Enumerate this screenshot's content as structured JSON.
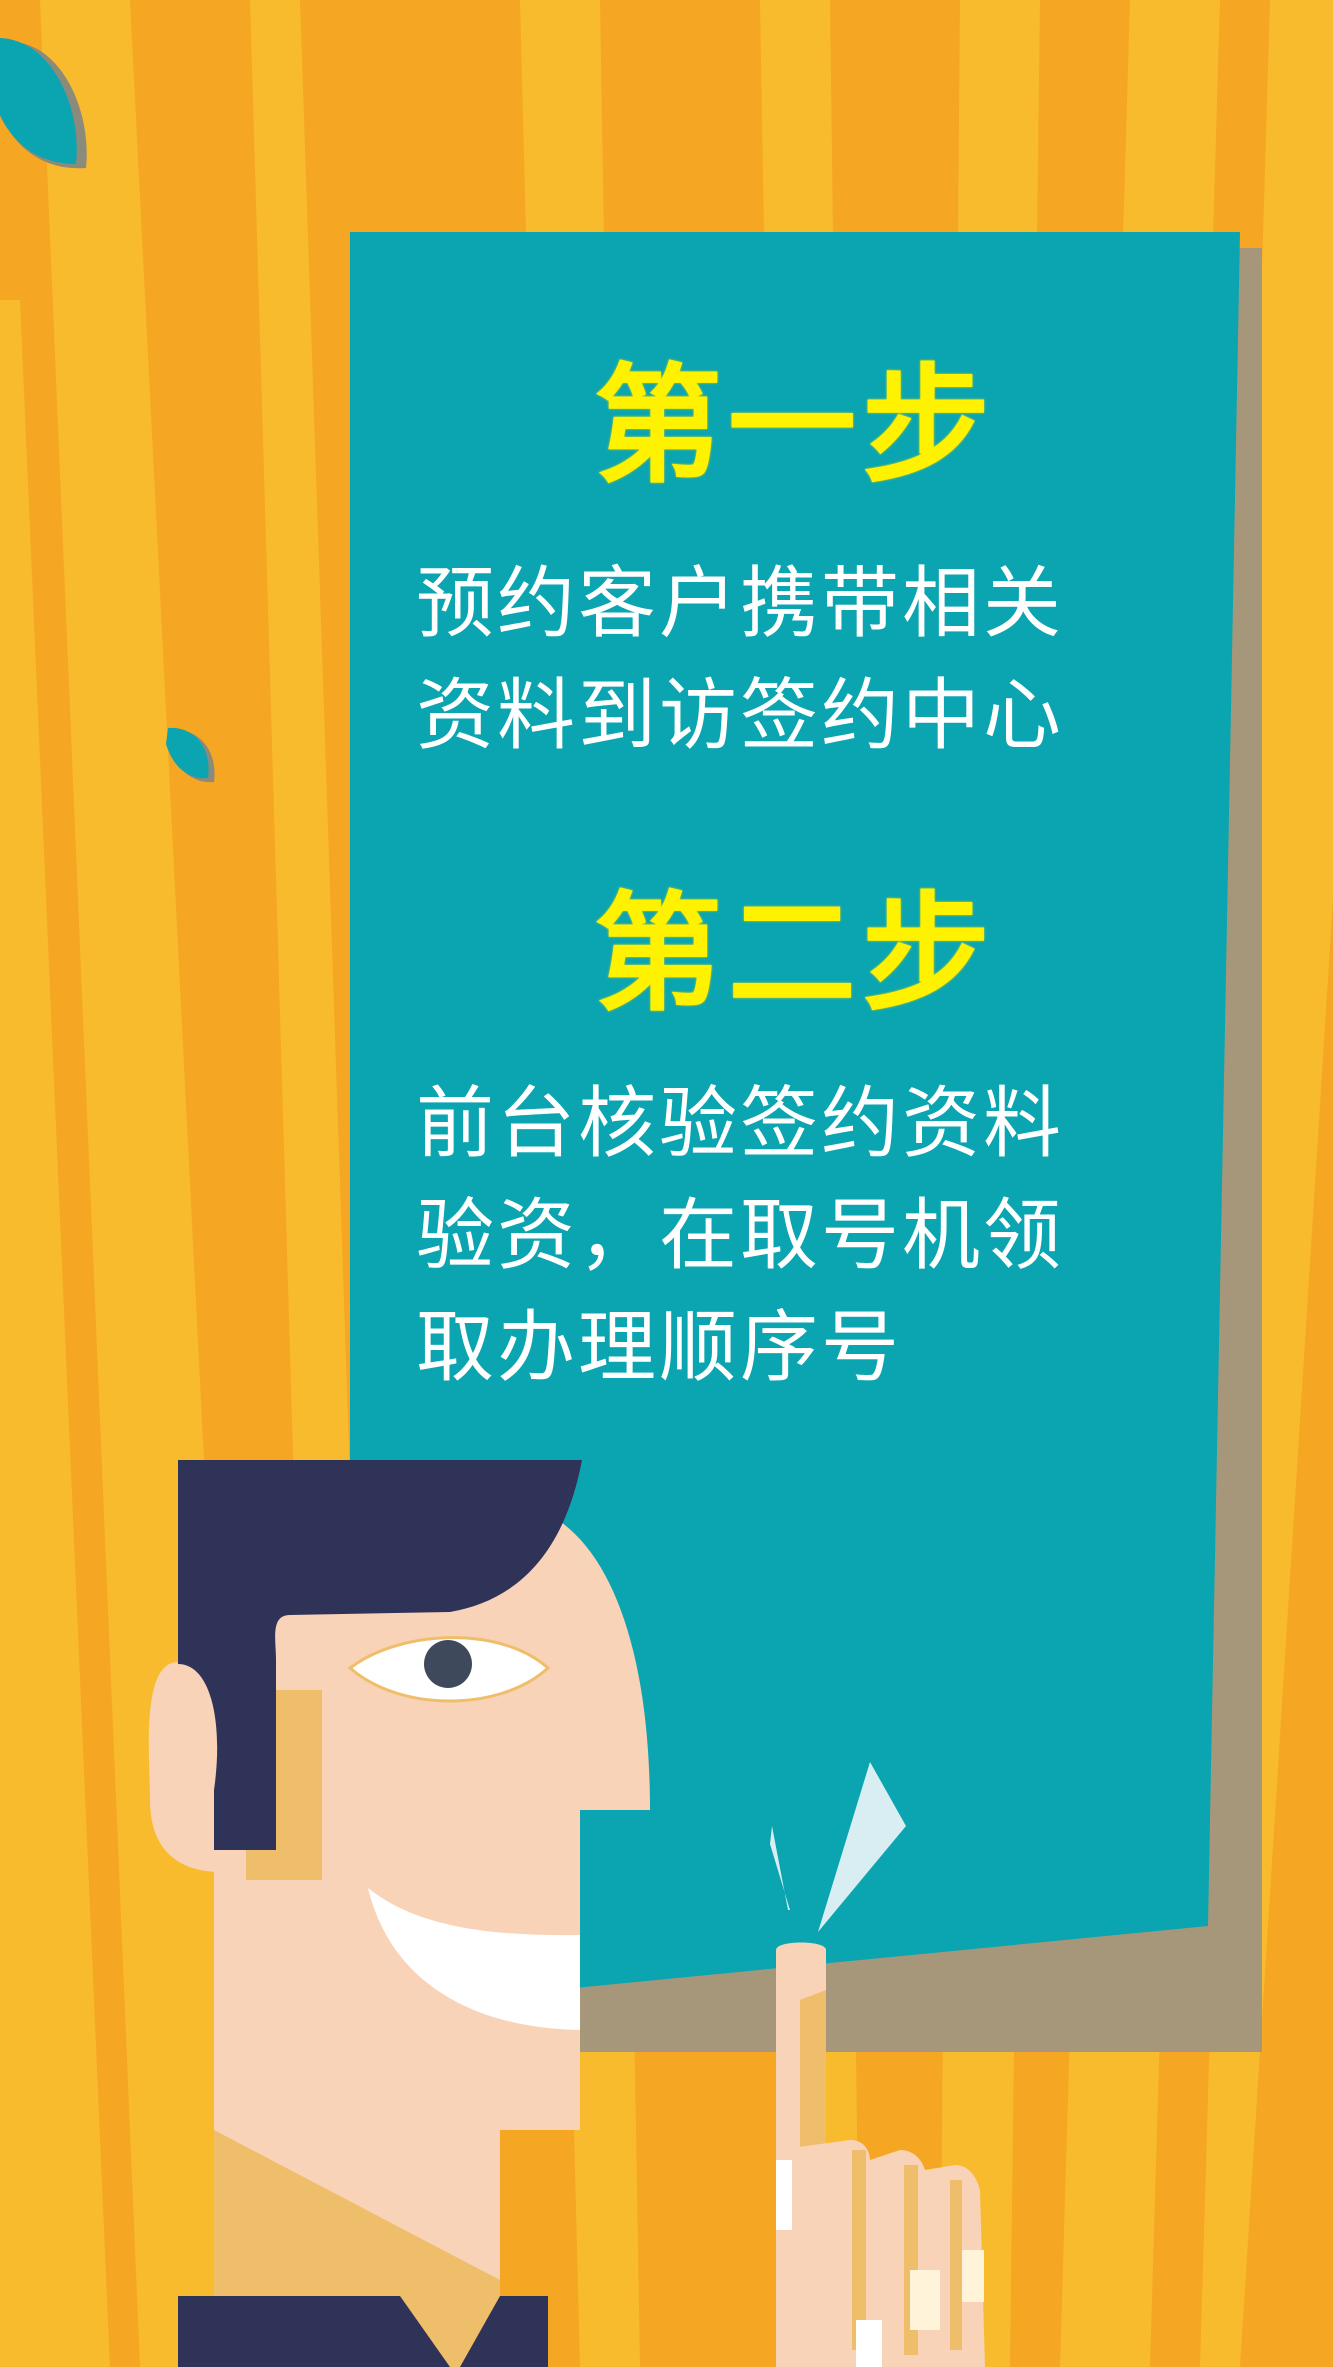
{
  "colors": {
    "background_orange": "#F5A623",
    "stripe_light": "#F8BB2E",
    "panel_teal": "#0AA5B0",
    "panel_shadow": "#A7977A",
    "title_yellow": "#FFF200",
    "body_text_white": "#FFFFFF",
    "hair_navy": "#2F3358",
    "skin": "#F8D3B8",
    "skin_shadow": "#EFBE6A"
  },
  "step1": {
    "title": "第一步",
    "lines": [
      "预约客户携带相关",
      "资料到访签约中心"
    ]
  },
  "step2": {
    "title": "第二步",
    "lines": [
      "前台核验签约资料",
      "验资，在取号机领",
      "取办理顺序号"
    ]
  }
}
